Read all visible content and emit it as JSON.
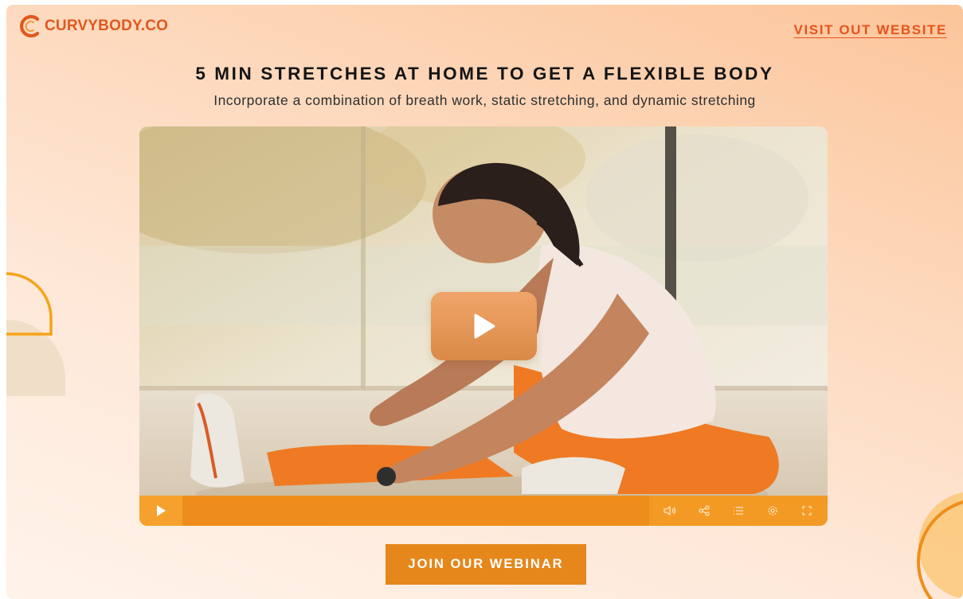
{
  "brand": {
    "name": "CURVYBODY.CO",
    "logo_icon": "crescent-c-logo",
    "color": "#e0581e"
  },
  "header": {
    "visit_link": "VISIT OUT WEBSITE"
  },
  "hero": {
    "title": "5 MIN STRETCHES AT HOME TO GET A FLEXIBLE BODY",
    "subtitle": "Incorporate a combination of breath work, static stretching, and dynamic stretching"
  },
  "video": {
    "play_icon": "play-icon",
    "progress": 0,
    "controls": [
      {
        "name": "volume",
        "icon": "volume-icon"
      },
      {
        "name": "share",
        "icon": "share-icon"
      },
      {
        "name": "playlist",
        "icon": "list-icon"
      },
      {
        "name": "settings",
        "icon": "gear-icon"
      },
      {
        "name": "fullscreen",
        "icon": "fullscreen-icon"
      }
    ]
  },
  "cta": {
    "label": "JOIN OUR WEBINAR"
  },
  "colors": {
    "accent": "#e5871b",
    "link": "#e8531c",
    "controls_bar": "#f08e1c",
    "background_start": "#fcc59a",
    "background_end": "#fff3ea"
  }
}
